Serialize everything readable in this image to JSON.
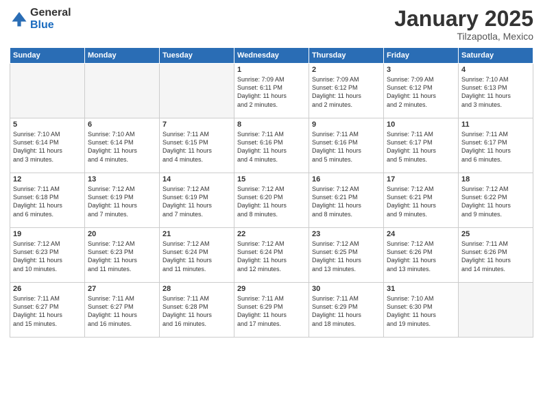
{
  "header": {
    "logo_general": "General",
    "logo_blue": "Blue",
    "month": "January 2025",
    "location": "Tilzapotla, Mexico"
  },
  "weekdays": [
    "Sunday",
    "Monday",
    "Tuesday",
    "Wednesday",
    "Thursday",
    "Friday",
    "Saturday"
  ],
  "weeks": [
    [
      {
        "day": "",
        "info": ""
      },
      {
        "day": "",
        "info": ""
      },
      {
        "day": "",
        "info": ""
      },
      {
        "day": "1",
        "info": "Sunrise: 7:09 AM\nSunset: 6:11 PM\nDaylight: 11 hours\nand 2 minutes."
      },
      {
        "day": "2",
        "info": "Sunrise: 7:09 AM\nSunset: 6:12 PM\nDaylight: 11 hours\nand 2 minutes."
      },
      {
        "day": "3",
        "info": "Sunrise: 7:09 AM\nSunset: 6:12 PM\nDaylight: 11 hours\nand 2 minutes."
      },
      {
        "day": "4",
        "info": "Sunrise: 7:10 AM\nSunset: 6:13 PM\nDaylight: 11 hours\nand 3 minutes."
      }
    ],
    [
      {
        "day": "5",
        "info": "Sunrise: 7:10 AM\nSunset: 6:14 PM\nDaylight: 11 hours\nand 3 minutes."
      },
      {
        "day": "6",
        "info": "Sunrise: 7:10 AM\nSunset: 6:14 PM\nDaylight: 11 hours\nand 4 minutes."
      },
      {
        "day": "7",
        "info": "Sunrise: 7:11 AM\nSunset: 6:15 PM\nDaylight: 11 hours\nand 4 minutes."
      },
      {
        "day": "8",
        "info": "Sunrise: 7:11 AM\nSunset: 6:16 PM\nDaylight: 11 hours\nand 4 minutes."
      },
      {
        "day": "9",
        "info": "Sunrise: 7:11 AM\nSunset: 6:16 PM\nDaylight: 11 hours\nand 5 minutes."
      },
      {
        "day": "10",
        "info": "Sunrise: 7:11 AM\nSunset: 6:17 PM\nDaylight: 11 hours\nand 5 minutes."
      },
      {
        "day": "11",
        "info": "Sunrise: 7:11 AM\nSunset: 6:17 PM\nDaylight: 11 hours\nand 6 minutes."
      }
    ],
    [
      {
        "day": "12",
        "info": "Sunrise: 7:11 AM\nSunset: 6:18 PM\nDaylight: 11 hours\nand 6 minutes."
      },
      {
        "day": "13",
        "info": "Sunrise: 7:12 AM\nSunset: 6:19 PM\nDaylight: 11 hours\nand 7 minutes."
      },
      {
        "day": "14",
        "info": "Sunrise: 7:12 AM\nSunset: 6:19 PM\nDaylight: 11 hours\nand 7 minutes."
      },
      {
        "day": "15",
        "info": "Sunrise: 7:12 AM\nSunset: 6:20 PM\nDaylight: 11 hours\nand 8 minutes."
      },
      {
        "day": "16",
        "info": "Sunrise: 7:12 AM\nSunset: 6:21 PM\nDaylight: 11 hours\nand 8 minutes."
      },
      {
        "day": "17",
        "info": "Sunrise: 7:12 AM\nSunset: 6:21 PM\nDaylight: 11 hours\nand 9 minutes."
      },
      {
        "day": "18",
        "info": "Sunrise: 7:12 AM\nSunset: 6:22 PM\nDaylight: 11 hours\nand 9 minutes."
      }
    ],
    [
      {
        "day": "19",
        "info": "Sunrise: 7:12 AM\nSunset: 6:23 PM\nDaylight: 11 hours\nand 10 minutes."
      },
      {
        "day": "20",
        "info": "Sunrise: 7:12 AM\nSunset: 6:23 PM\nDaylight: 11 hours\nand 11 minutes."
      },
      {
        "day": "21",
        "info": "Sunrise: 7:12 AM\nSunset: 6:24 PM\nDaylight: 11 hours\nand 11 minutes."
      },
      {
        "day": "22",
        "info": "Sunrise: 7:12 AM\nSunset: 6:24 PM\nDaylight: 11 hours\nand 12 minutes."
      },
      {
        "day": "23",
        "info": "Sunrise: 7:12 AM\nSunset: 6:25 PM\nDaylight: 11 hours\nand 13 minutes."
      },
      {
        "day": "24",
        "info": "Sunrise: 7:12 AM\nSunset: 6:26 PM\nDaylight: 11 hours\nand 13 minutes."
      },
      {
        "day": "25",
        "info": "Sunrise: 7:11 AM\nSunset: 6:26 PM\nDaylight: 11 hours\nand 14 minutes."
      }
    ],
    [
      {
        "day": "26",
        "info": "Sunrise: 7:11 AM\nSunset: 6:27 PM\nDaylight: 11 hours\nand 15 minutes."
      },
      {
        "day": "27",
        "info": "Sunrise: 7:11 AM\nSunset: 6:27 PM\nDaylight: 11 hours\nand 16 minutes."
      },
      {
        "day": "28",
        "info": "Sunrise: 7:11 AM\nSunset: 6:28 PM\nDaylight: 11 hours\nand 16 minutes."
      },
      {
        "day": "29",
        "info": "Sunrise: 7:11 AM\nSunset: 6:29 PM\nDaylight: 11 hours\nand 17 minutes."
      },
      {
        "day": "30",
        "info": "Sunrise: 7:11 AM\nSunset: 6:29 PM\nDaylight: 11 hours\nand 18 minutes."
      },
      {
        "day": "31",
        "info": "Sunrise: 7:10 AM\nSunset: 6:30 PM\nDaylight: 11 hours\nand 19 minutes."
      },
      {
        "day": "",
        "info": ""
      }
    ]
  ]
}
